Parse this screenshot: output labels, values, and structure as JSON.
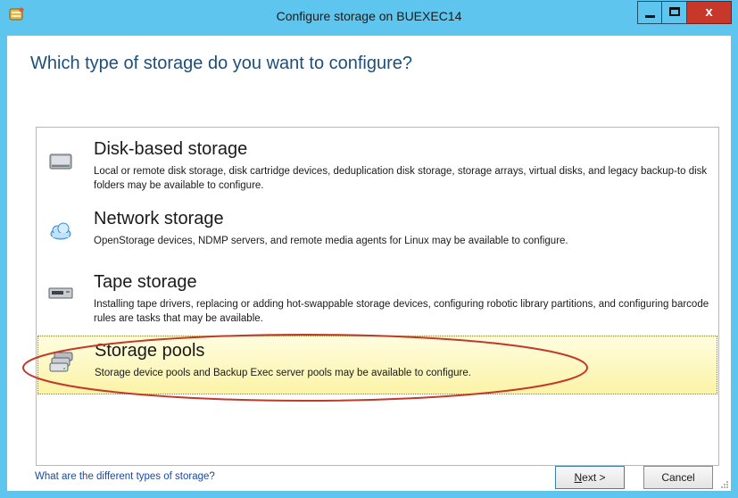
{
  "window": {
    "title": "Configure storage on BUEXEC14",
    "close_glyph": "x"
  },
  "heading": "Which type of storage do you want to configure?",
  "options": [
    {
      "title": "Disk-based storage",
      "description": "Local or remote disk storage, disk cartridge devices, deduplication disk storage, storage arrays, virtual disks, and legacy backup-to disk folders may be available to configure.",
      "icon": "hard-disk-icon"
    },
    {
      "title": "Network storage",
      "description": "OpenStorage devices, NDMP servers, and remote media agents for Linux may be available to configure.",
      "icon": "cloud-icon"
    },
    {
      "title": "Tape storage",
      "description": "Installing tape drivers, replacing or adding hot-swappable storage devices, configuring robotic library partitions, and configuring barcode rules are tasks that may be available.",
      "icon": "tape-drive-icon"
    },
    {
      "title": "Storage pools",
      "description": "Storage device pools and Backup Exec server pools may be available to configure.",
      "icon": "storage-pool-icon",
      "selected": true
    }
  ],
  "footer": {
    "help_link": "What are the different types of storage?",
    "next_mnemonic": "N",
    "next_rest": "ext >",
    "cancel_label": "Cancel"
  },
  "colors": {
    "titlebar": "#5ec6ee",
    "heading": "#1e4e79",
    "close_button": "#c7382b",
    "selection_highlight": "#fbf3a6",
    "annotation_ellipse": "#c0392b",
    "link": "#1a4aa0"
  }
}
